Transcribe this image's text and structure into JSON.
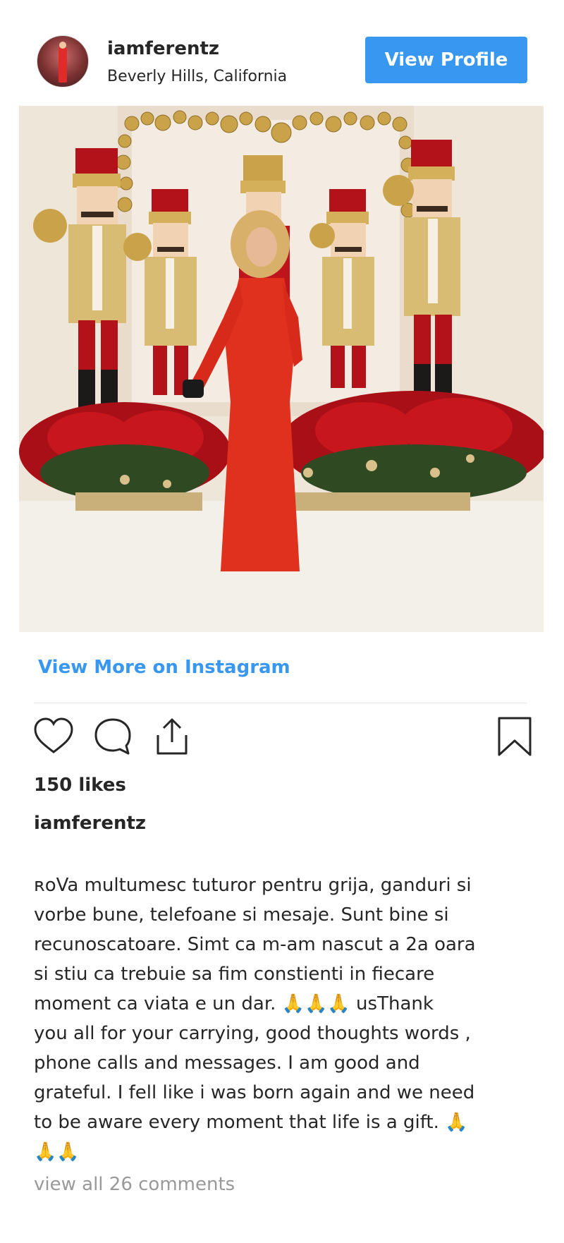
{
  "post": {
    "username": "iamferentz",
    "location": "Beverly Hills, California",
    "view_profile_label": "View Profile",
    "view_more_label": "View More on Instagram",
    "likes_text": "150 likes",
    "caption_username": "iamferentz",
    "caption_text": "ʀoVa multumesc tuturor pentru grija, ganduri si\nvorbe bune, telefoane si mesaje. Sunt bine si\nrecunoscatoare. Simt ca m-am nascut a 2a oara\nsi stiu ca trebuie sa fim constienti in fiecare\nmoment ca viata e un dar. 🙏🙏🙏 usThank\nyou all for your carrying, good thoughts words ,\nphone calls and messages. I am good and\ngrateful. I fell like i was born again and we need\nto be aware every moment that life is a gift. 🙏\n🙏🙏",
    "comments_link": "view all 26 comments"
  },
  "icons": {
    "like": "heart-icon",
    "comment": "comment-bubble-icon",
    "share": "share-upload-icon",
    "save": "bookmark-icon"
  },
  "colors": {
    "accent": "#3897f0",
    "text": "#262626",
    "muted": "#999999",
    "dress": "#e0301e",
    "poinsettia": "#c0141c",
    "gold": "#c9a24a"
  }
}
